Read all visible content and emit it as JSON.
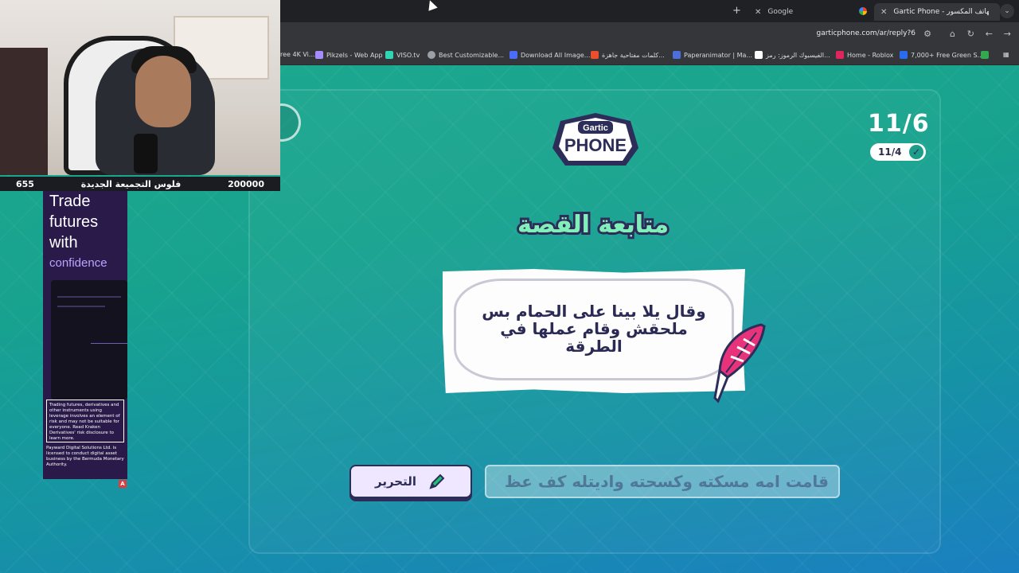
{
  "browser": {
    "tabs": [
      {
        "title": "Google",
        "active": false
      },
      {
        "title": "Gartic Phone - الهاتف المكسور",
        "active": true
      }
    ],
    "url": "garticphone.com/ar/reply?6",
    "bookmarks": [
      "ree 4K Vi...",
      "Pikzels - Web App",
      "VISO.tv",
      "Best Customizable...",
      "Download All Image...",
      "كلمات مفتاحية جاهزة...",
      "Paperanimator | Ma...",
      "الفيسبوك الرموز: رمز...",
      "Home - Roblox",
      "7,000+ Free Green S..."
    ]
  },
  "stream": {
    "left_value": "655",
    "label": "فلوس التجميعة الجديدة",
    "right_value": "200000"
  },
  "ad": {
    "line1": "Trade",
    "line2": "futures",
    "line3": "with",
    "line4": "confidence",
    "disclaimer": "Trading futures, derivatives and other instruments using leverage involves an element of risk and may not be suitable for everyone. Read Kraken Derivatives' risk disclosure to learn more.",
    "footer": "Payward Digital Solutions Ltd. is licensed to conduct digital asset business by the Bermuda Monetary Authority.",
    "badge": "A"
  },
  "game": {
    "logo_top": "Gartic",
    "logo_bottom": "PHONE",
    "round": "11/6",
    "done": "11/4",
    "heading": "متابعة القصة",
    "story": "وقال يلا بينا على الحمام بس ملحقش وقام عملها في الطرقة",
    "edit_label": "التحرير",
    "answer": "قامت امه مسكته وكسحته واديتله كف عظ"
  },
  "colors": {
    "accent_navy": "#2d2d5a",
    "heading_green": "#7ef0b8",
    "quill_pink": "#e8337a"
  }
}
